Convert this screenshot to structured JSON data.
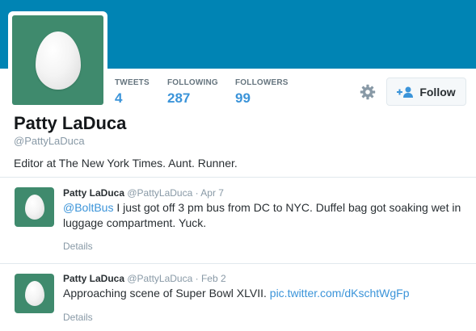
{
  "profile": {
    "name": "Patty LaDuca",
    "handle": "@PattyLaDuca",
    "bio": "Editor at The New York Times. Aunt. Runner.",
    "banner_color": "#0084b4",
    "avatar_color": "#3f8a6d",
    "avatar_icon": "egg-icon"
  },
  "stats": [
    {
      "label": "TWEETS",
      "value": "4"
    },
    {
      "label": "FOLLOWING",
      "value": "287"
    },
    {
      "label": "FOLLOWERS",
      "value": "99"
    }
  ],
  "actions": {
    "settings_icon": "gear-icon",
    "follow_label": "Follow",
    "follow_icon": "add-user-icon"
  },
  "tweets": [
    {
      "name": "Patty LaDuca",
      "handle": "@PattyLaDuca",
      "separator": " · ",
      "date": "Apr 7",
      "mention": "@BoltBus",
      "text": " I just got off  3 pm bus from DC to NYC. Duffel bag got soaking wet in luggage compartment. Yuck.",
      "details": "Details"
    },
    {
      "name": "Patty LaDuca",
      "handle": "@PattyLaDuca",
      "separator": " · ",
      "date": "Feb 2",
      "text": "Approaching scene of Super Bowl XLVII. ",
      "link": "pic.twitter.com/dKschtWgFp",
      "details": "Details"
    }
  ],
  "colors": {
    "link": "#3b94d9",
    "muted": "#8899a6"
  }
}
